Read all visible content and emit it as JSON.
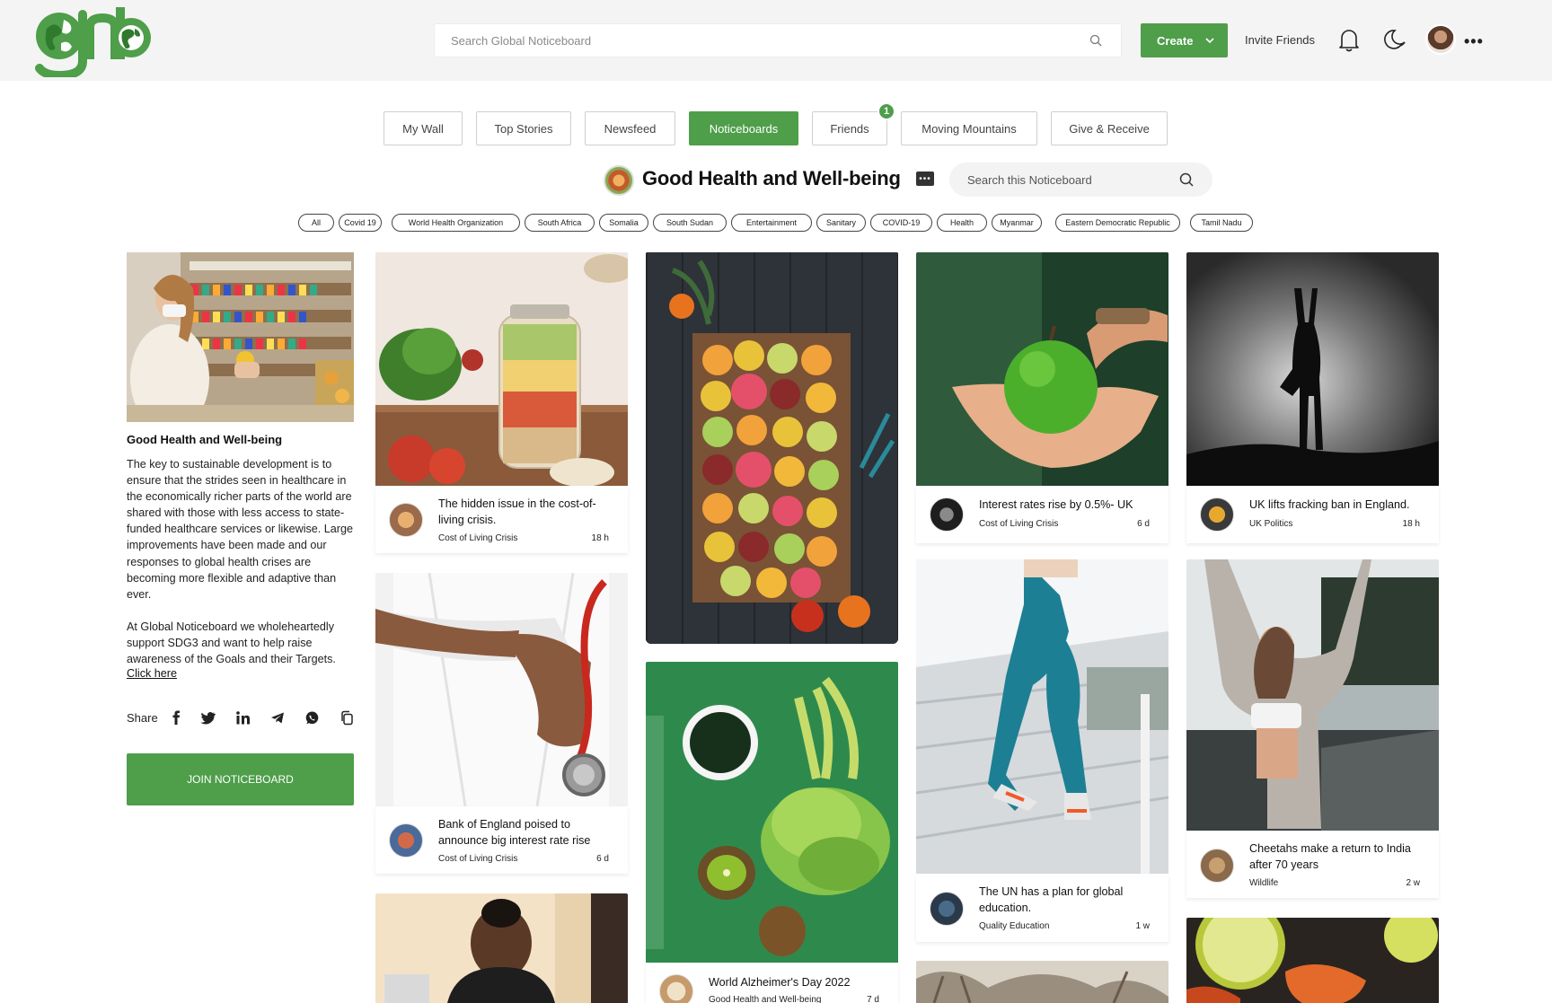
{
  "header": {
    "logo_text": "gnb",
    "search_placeholder": "Search Global Noticeboard",
    "create_label": "Create",
    "invite_label": "Invite Friends",
    "more_label": "•••"
  },
  "tabs": [
    {
      "label": "My Wall"
    },
    {
      "label": "Top Stories"
    },
    {
      "label": "Newsfeed"
    },
    {
      "label": "Noticeboards"
    },
    {
      "label": "Friends"
    },
    {
      "label": "Moving Mountains"
    },
    {
      "label": "Give & Receive"
    }
  ],
  "friends_badge": "1",
  "noticeboard": {
    "title": "Good  Health and Well-being",
    "menu_label": "•••",
    "search_placeholder": "Search this Noticeboard"
  },
  "chips": [
    "All",
    "Covid 19",
    "World Health Organization",
    "South Africa",
    "Somalia",
    "South Sudan",
    "Entertainment",
    "Sanitary",
    "COVID-19",
    "Health",
    "Myanmar",
    "Eastern Democratic Republic",
    "Tamil Nadu"
  ],
  "sidebar": {
    "title": "Good  Health and Well-being",
    "description": "The key to sustainable development is to ensure that the strides seen in healthcare in the economically richer parts of the world are shared with those with less access to state-funded healthcare services or likewise. Large improvements have been made and our responses to global health crises are becoming more flexible and adaptive than ever.",
    "description2": "At Global Noticeboard we wholeheartedly support SDG3 and want to help raise awareness of the Goals and their Targets.",
    "click_here": "Click here",
    "share_label": "Share",
    "share_icons": [
      "facebook-icon",
      "twitter-icon",
      "linkedin-icon",
      "telegram-icon",
      "whatsapp-icon",
      "copy-icon"
    ],
    "join_label": "JOIN NOTICEBOARD"
  },
  "cards": [
    {
      "title": "The hidden issue in the cost-of-living crisis.",
      "category": "Cost of Living Crisis",
      "time": "18 h"
    },
    {
      "title": "Bank of England poised to announce big interest rate rise",
      "category": "Cost of Living Crisis",
      "time": "6 d"
    },
    {
      "title": "World Alzheimer's Day 2022",
      "category": "Good Health and Well-being",
      "time": "7 d"
    },
    {
      "title": "Interest rates rise by 0.5%- UK",
      "category": "Cost of Living Crisis",
      "time": "6 d"
    },
    {
      "title": "The UN has a plan for global education.",
      "category": "Quality Education",
      "time": "1 w"
    },
    {
      "title": "UK lifts fracking ban in England.",
      "category": "UK Politics",
      "time": "18 h"
    },
    {
      "title": "Cheetahs make a return to India after 70 years",
      "category": "Wildlife",
      "time": "2 w"
    }
  ],
  "colors": {
    "accent": "#4e9e4a",
    "header_bg": "#f4f4f4"
  }
}
